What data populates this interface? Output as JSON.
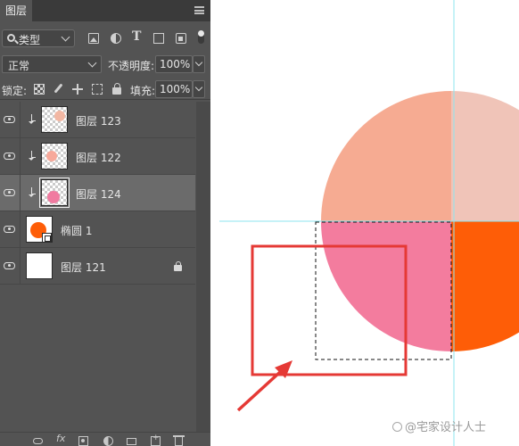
{
  "panel": {
    "tab_label": "图层",
    "menu_icon": "hamburger-menu-icon"
  },
  "filter": {
    "kind_label": "类型",
    "icons": [
      "pixel-filter-icon",
      "adjustment-filter-icon",
      "type-filter-icon",
      "shape-filter-icon",
      "smart-object-filter-icon"
    ]
  },
  "blend": {
    "mode": "正常",
    "opacity_label": "不透明度:",
    "opacity_value": "100%"
  },
  "lock": {
    "label": "锁定:",
    "fill_label": "填充:",
    "fill_value": "100%"
  },
  "layers": [
    {
      "name": "图层 123",
      "clipped": true,
      "selected": false,
      "thumb_color": "#f2b7a3"
    },
    {
      "name": "图层 122",
      "clipped": true,
      "selected": false,
      "thumb_color": "#f7a99b"
    },
    {
      "name": "图层 124",
      "clipped": true,
      "selected": true,
      "thumb_color": "#f07ba0"
    },
    {
      "name": "椭圆 1",
      "clipped": false,
      "selected": false,
      "thumb_color": "#fe5d07"
    },
    {
      "name": "图层 121",
      "clipped": false,
      "selected": false,
      "locked": true,
      "thumb_color": "#ffffff"
    }
  ],
  "bottom_icons": [
    "link-icon",
    "fx-icon",
    "mask-icon",
    "adjustment-icon",
    "folder-icon",
    "new-layer-icon",
    "trash-icon"
  ],
  "bottom": {
    "fx_label": "fx"
  },
  "canvas": {
    "colors": {
      "top_left": "#f6ab92",
      "top_right": "#f0c4b8",
      "bottom_left": "#f37c9e",
      "bottom_right": "#fe5d07",
      "guide": "#8de6ef",
      "annotation": "#e53935"
    },
    "watermark": "@宅家设计人士"
  }
}
